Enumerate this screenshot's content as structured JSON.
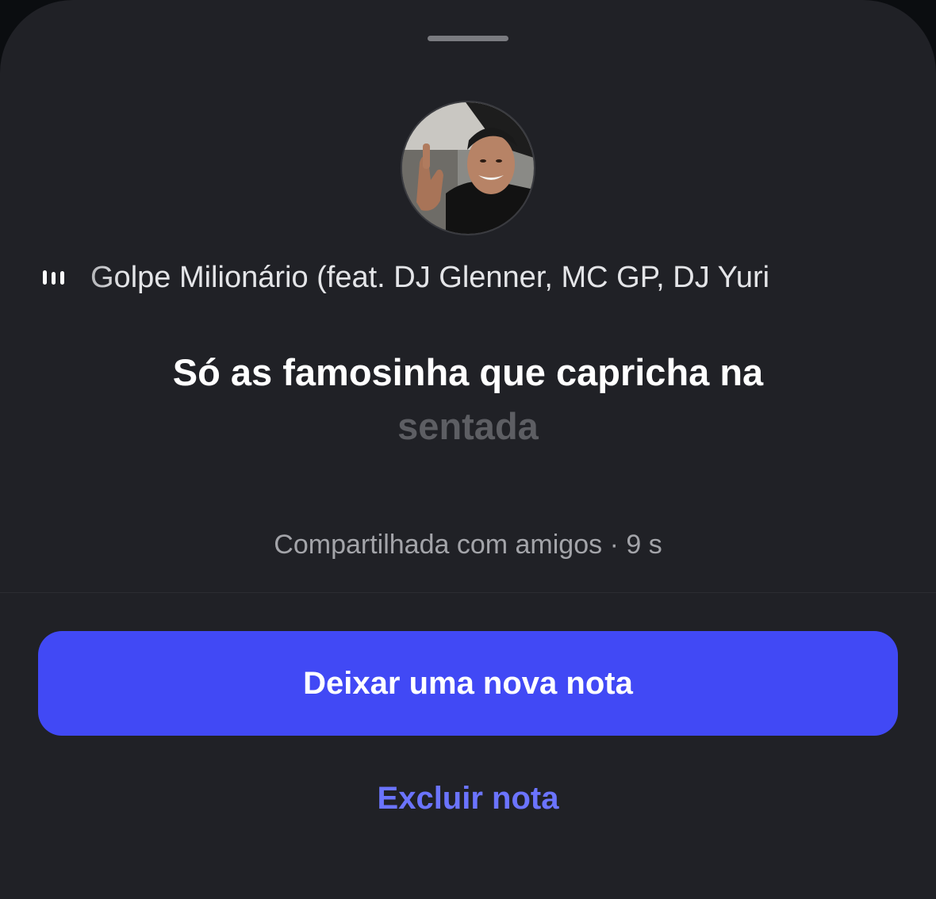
{
  "note": {
    "song_title": "Golpe Milionário (feat. DJ Glenner, MC GP, DJ Yuri",
    "music_icon": "audio-bars-icon",
    "lyric_current": "Só as famosinha que capricha na",
    "lyric_next": "sentada",
    "meta": "Compartilhada com amigos · 9 s"
  },
  "actions": {
    "primary_label": "Deixar uma nova nota",
    "secondary_label": "Excluir nota"
  },
  "colors": {
    "sheet_background": "#202126",
    "primary_button": "#4149f5",
    "link": "#6b74ff",
    "lyric_inactive": "#5d5e63"
  }
}
